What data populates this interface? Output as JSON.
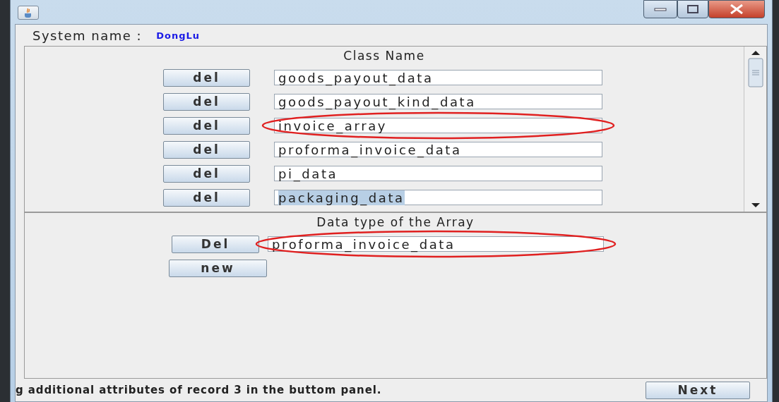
{
  "system": {
    "label": "System name :",
    "value": "DongLu"
  },
  "class_panel": {
    "heading": "Class Name",
    "rows": [
      {
        "button": "del",
        "value": "goods_payout_data",
        "highlighted": false,
        "text_selected": false
      },
      {
        "button": "del",
        "value": "goods_payout_kind_data",
        "highlighted": false,
        "text_selected": false
      },
      {
        "button": "del",
        "value": "invoice_array",
        "highlighted": true,
        "text_selected": false
      },
      {
        "button": "del",
        "value": "proforma_invoice_data",
        "highlighted": false,
        "text_selected": false
      },
      {
        "button": "del",
        "value": "pi_data",
        "highlighted": false,
        "text_selected": false
      },
      {
        "button": "del",
        "value": "packaging_data",
        "highlighted": false,
        "text_selected": true
      }
    ]
  },
  "array_panel": {
    "heading": "Data type of the Array",
    "button": "Del",
    "value": "proforma_invoice_data",
    "highlighted": true,
    "new_button": "new"
  },
  "status_bar": {
    "message": "g additional attributes of record 3 in the buttom panel.",
    "next_button": "Next"
  }
}
